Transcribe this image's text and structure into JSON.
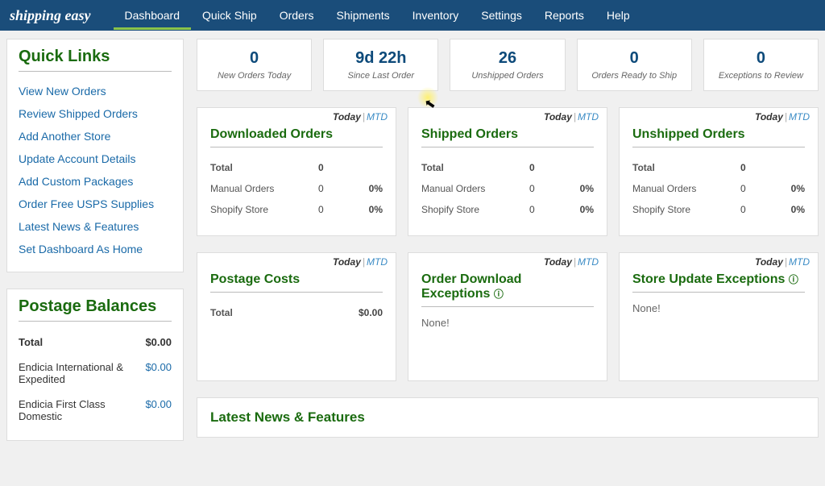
{
  "brand": "shipping easy",
  "nav": [
    "Dashboard",
    "Quick Ship",
    "Orders",
    "Shipments",
    "Inventory",
    "Settings",
    "Reports",
    "Help"
  ],
  "quicklinks": {
    "title": "Quick Links",
    "items": [
      "View New Orders",
      "Review Shipped Orders",
      "Add Another Store",
      "Update Account Details",
      "Add Custom Packages",
      "Order Free USPS Supplies",
      "Latest News & Features",
      "Set Dashboard As Home"
    ]
  },
  "postage": {
    "title": "Postage Balances",
    "total_label": "Total",
    "total_value": "$0.00",
    "rows": [
      {
        "label": "Endicia International & Expedited",
        "value": "$0.00"
      },
      {
        "label": "Endicia First Class Domestic",
        "value": "$0.00"
      }
    ]
  },
  "kpis": [
    {
      "value": "0",
      "label": "New Orders Today"
    },
    {
      "value": "9d 22h",
      "label": "Since Last Order"
    },
    {
      "value": "26",
      "label": "Unshipped Orders"
    },
    {
      "value": "0",
      "label": "Orders Ready to Ship"
    },
    {
      "value": "0",
      "label": "Exceptions to Review"
    }
  ],
  "tabs": {
    "today": "Today",
    "sep": "|",
    "mtd": "MTD"
  },
  "order_cards": [
    {
      "title": "Downloaded Orders",
      "total_label": "Total",
      "total_value": "0",
      "rows": [
        {
          "label": "Manual Orders",
          "count": "0",
          "pct": "0%"
        },
        {
          "label": "Shopify Store",
          "count": "0",
          "pct": "0%"
        }
      ]
    },
    {
      "title": "Shipped Orders",
      "total_label": "Total",
      "total_value": "0",
      "rows": [
        {
          "label": "Manual Orders",
          "count": "0",
          "pct": "0%"
        },
        {
          "label": "Shopify Store",
          "count": "0",
          "pct": "0%"
        }
      ]
    },
    {
      "title": "Unshipped Orders",
      "total_label": "Total",
      "total_value": "0",
      "rows": [
        {
          "label": "Manual Orders",
          "count": "0",
          "pct": "0%"
        },
        {
          "label": "Shopify Store",
          "count": "0",
          "pct": "0%"
        }
      ]
    }
  ],
  "lower_cards": {
    "postage_costs": {
      "title": "Postage Costs",
      "total_label": "Total",
      "total_value": "$0.00"
    },
    "download_ex": {
      "title": "Order Download Exceptions",
      "body": "None!"
    },
    "store_ex": {
      "title": "Store Update Exceptions",
      "body": "None!"
    }
  },
  "latest": {
    "title": "Latest News & Features"
  }
}
